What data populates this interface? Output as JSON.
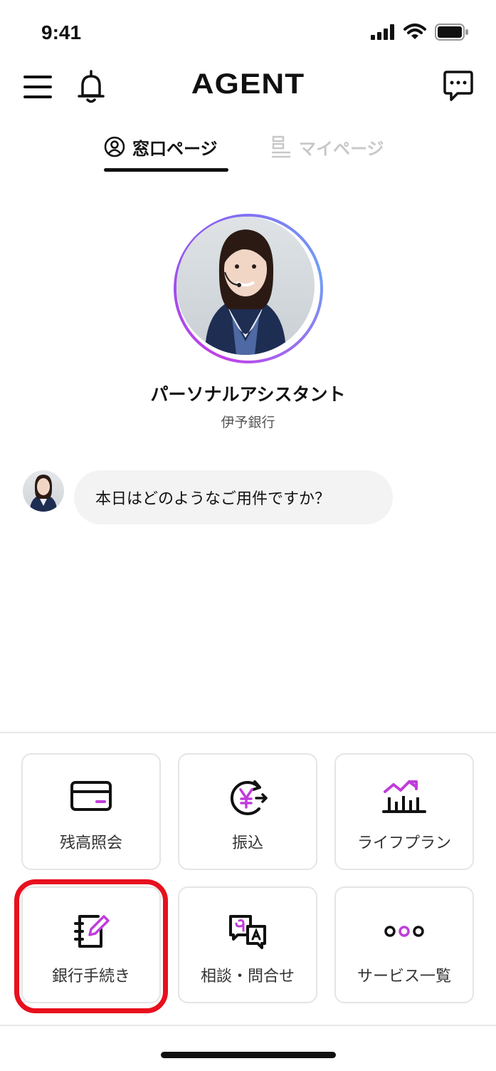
{
  "status_bar": {
    "time": "9:41"
  },
  "header": {
    "logo": "AGENT"
  },
  "tabs": [
    {
      "label": "窓口ページ",
      "active": true
    },
    {
      "label": "マイページ",
      "active": false
    }
  ],
  "assistant": {
    "name": "パーソナルアシスタント",
    "bank": "伊予銀行"
  },
  "chat": {
    "message": "本日はどのようなご用件ですか？"
  },
  "menu": [
    {
      "label": "残高照会",
      "icon": "card-icon"
    },
    {
      "label": "振込",
      "icon": "yen-transfer-icon"
    },
    {
      "label": "ライフプラン",
      "icon": "growth-chart-icon"
    },
    {
      "label": "銀行手続き",
      "icon": "notebook-pen-icon"
    },
    {
      "label": "相談・問合せ",
      "icon": "consult-chat-icon"
    },
    {
      "label": "サービス一覧",
      "icon": "more-dots-icon"
    }
  ],
  "colors": {
    "accent": "#c03cdc",
    "highlight": "#e8101e",
    "text": "#111111"
  }
}
